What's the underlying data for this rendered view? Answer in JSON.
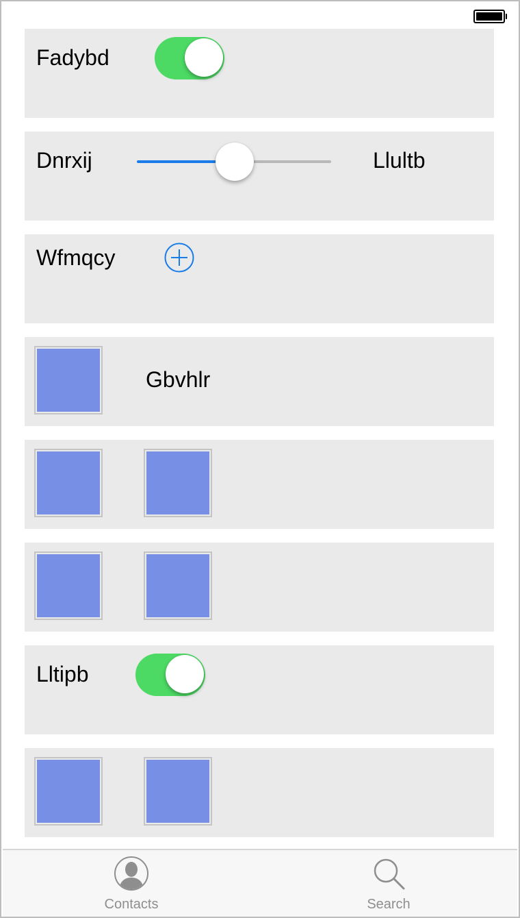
{
  "status_bar": {
    "battery_icon": "battery-full-icon"
  },
  "rows": [
    {
      "type": "toggle",
      "label": "Fadybd",
      "toggle_on": true
    },
    {
      "type": "slider",
      "label": "Dnrxij",
      "value_label": "Llultb",
      "slider_value": 0.5
    },
    {
      "type": "add",
      "label": "Wfmqcy",
      "icon": "add-circle-icon"
    },
    {
      "type": "image-label",
      "label": "Gbvhlr"
    },
    {
      "type": "images"
    },
    {
      "type": "images"
    },
    {
      "type": "toggle",
      "label": "Lltipb",
      "toggle_on": true
    },
    {
      "type": "images"
    }
  ],
  "tabbar": {
    "tabs": [
      {
        "label": "Contacts",
        "icon": "contact-person-icon"
      },
      {
        "label": "Search",
        "icon": "search-icon"
      }
    ]
  },
  "colors": {
    "toggle_on": "#4cd964",
    "slider_min_track": "#1a7ce8",
    "slider_max_track": "#b8b8b8",
    "accent": "#1a7ce8",
    "image_fill": "#7790e5",
    "row_background": "#eaeaea",
    "tab_label": "#8e8e8e"
  }
}
